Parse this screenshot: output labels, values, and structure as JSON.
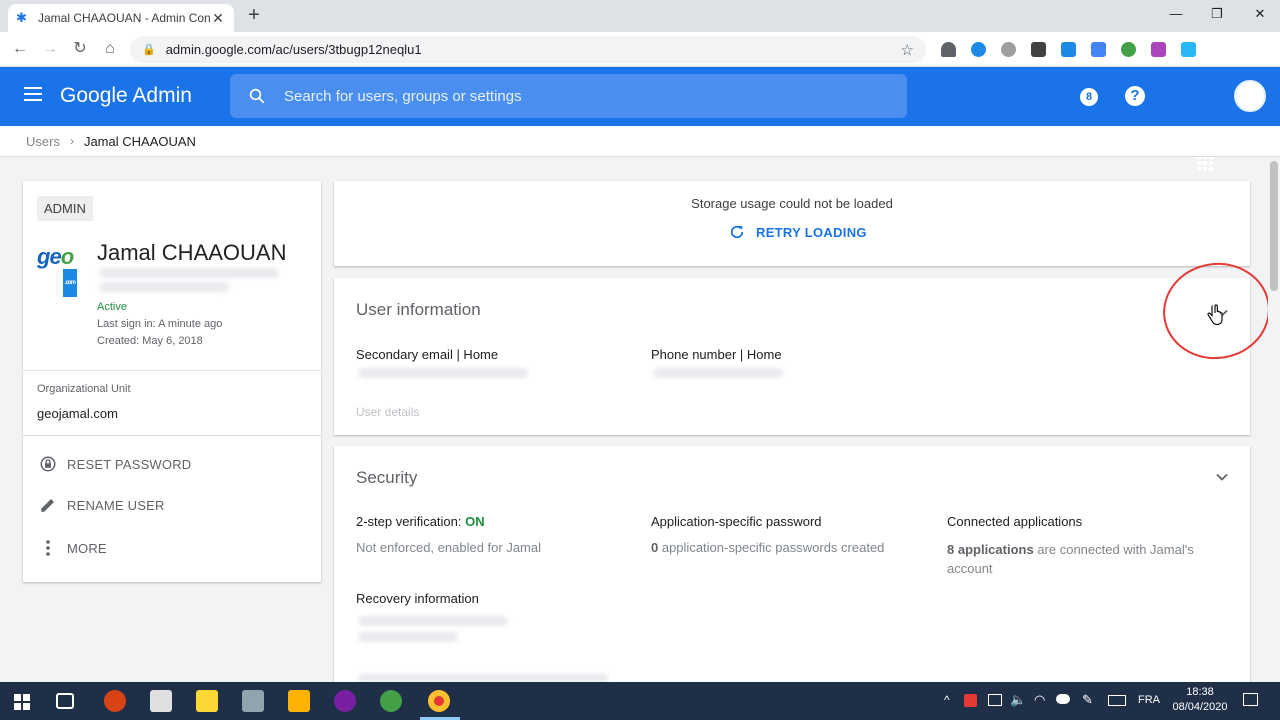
{
  "browser": {
    "tab_title": "Jamal CHAAOUAN - Admin Cons",
    "url": "admin.google.com/ac/users/3tbugp12neqlu1"
  },
  "header": {
    "brand": "Google Admin",
    "search_placeholder": "Search for users, groups or settings",
    "help_icon": "help-icon",
    "apps_icon": "apps-grid-icon"
  },
  "breadcrumb": {
    "root": "Users",
    "current": "Jamal CHAAOUAN"
  },
  "user_card": {
    "role_badge": "ADMIN",
    "name": "Jamal CHAAOUAN",
    "status": "Active",
    "last_sign_in": "Last sign in: A minute ago",
    "created": "Created: May 6, 2018",
    "org_unit_label": "Organizational Unit",
    "org_unit_value": "geojamal.com",
    "actions": [
      "RESET PASSWORD",
      "RENAME USER",
      "MORE"
    ]
  },
  "storage": {
    "message": "Storage usage could not be loaded",
    "retry_label": "RETRY LOADING"
  },
  "user_info": {
    "title": "User information",
    "secondary_email_label": "Secondary email | Home",
    "phone_label": "Phone number | Home",
    "details_link": "User details"
  },
  "security": {
    "title": "Security",
    "two_step_label": "2-step verification: ",
    "two_step_value": "ON",
    "two_step_sub": "Not enforced, enabled for Jamal",
    "app_pw_label": "Application-specific password",
    "app_pw_count": "0",
    "app_pw_sub": " application-specific passwords created",
    "connected_label": "Connected applications",
    "connected_count": "8 applications",
    "connected_sub": " are connected with Jamal's account",
    "recovery_label": "Recovery information"
  },
  "system_tray": {
    "language": "FRA",
    "time": "18:38",
    "date": "08/04/2020"
  },
  "colors": {
    "brand_blue": "#1a73e8",
    "active_green": "#1e8e3e",
    "annotation_red": "#e53935"
  }
}
